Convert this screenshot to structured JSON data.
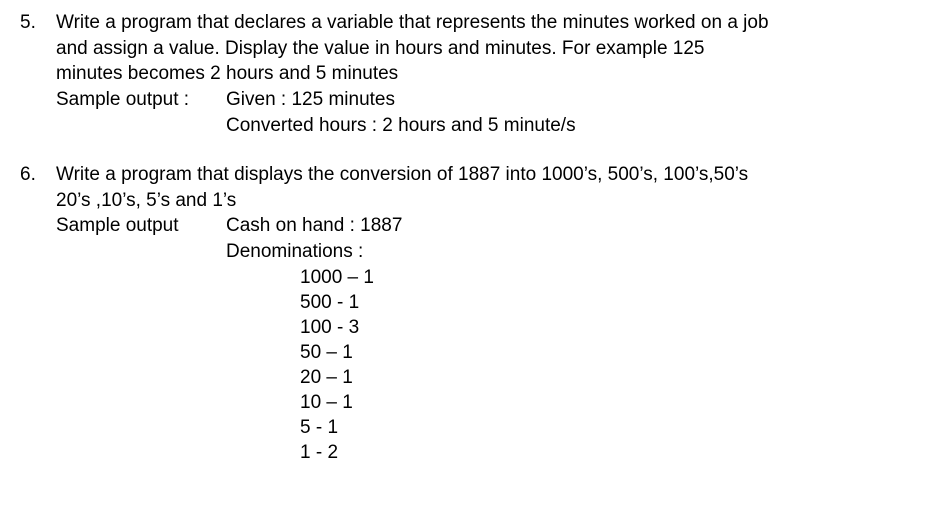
{
  "q5": {
    "number": "5.",
    "prompt_line1": "Write a program that declares a variable that represents the minutes worked on a job",
    "prompt_line2": "and assign a value.  Display the value in hours and minutes.  For example 125",
    "prompt_line3": "minutes becomes 2 hours and 5 minutes",
    "sample_label": "Sample output :",
    "sample_line1": "Given  : 125 minutes",
    "sample_line2": "Converted hours : 2 hours  and 5 minute/s"
  },
  "q6": {
    "number": "6.",
    "prompt_line1": "Write a program that displays the conversion of 1887 into 1000’s, 500’s, 100’s,50’s",
    "prompt_line2": "20’s ,10’s, 5’s and 1’s",
    "sample_label": "Sample output",
    "sample_line1": "Cash on hand : 1887",
    "sample_line2": "Denominations :",
    "denominations": [
      "1000 – 1",
      "500 -  1",
      "100 -  3",
      "50 – 1",
      "20 – 1",
      "10 – 1",
      "5 - 1",
      "1 - 2"
    ]
  }
}
